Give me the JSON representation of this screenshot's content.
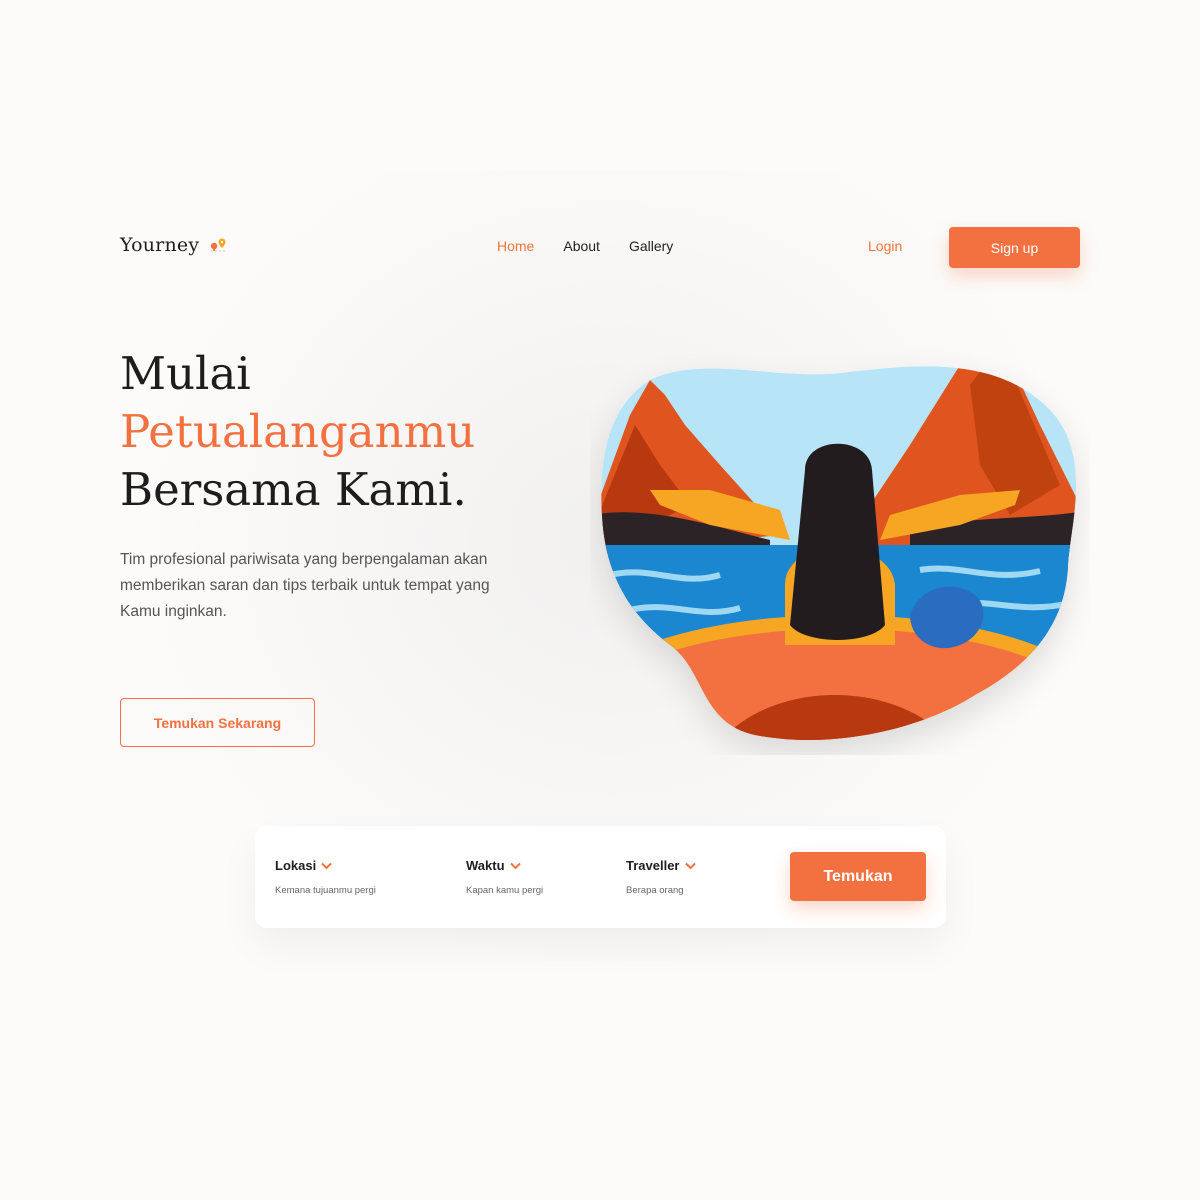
{
  "brand": {
    "name": "Yourney",
    "icon": "map-pin-icon",
    "accent_color": "#f37140"
  },
  "nav": {
    "items": [
      {
        "label": "Home",
        "active": true
      },
      {
        "label": "About",
        "active": false
      },
      {
        "label": "Gallery",
        "active": false
      }
    ],
    "login_label": "Login",
    "signup_label": "Sign up"
  },
  "hero": {
    "title_line1": "Mulai",
    "title_line2": "Petualanganmu",
    "title_line3": "Bersama Kami.",
    "description": "Tim profesional pariwisata yang berpengalaman akan memberikan saran dan tips terbaik untuk tempat yang Kamu inginkan.",
    "cta_label": "Temukan Sekarang",
    "illustration": "traveler-on-boat-illustration"
  },
  "search": {
    "fields": [
      {
        "label": "Lokasi",
        "hint": "Kemana tujuanmu pergi",
        "icon": "chevron-down-icon"
      },
      {
        "label": "Waktu",
        "hint": "Kapan kamu pergi",
        "icon": "chevron-down-icon"
      },
      {
        "label": "Traveller",
        "hint": "Berapa orang",
        "icon": "chevron-down-icon"
      }
    ],
    "button_label": "Temukan"
  }
}
